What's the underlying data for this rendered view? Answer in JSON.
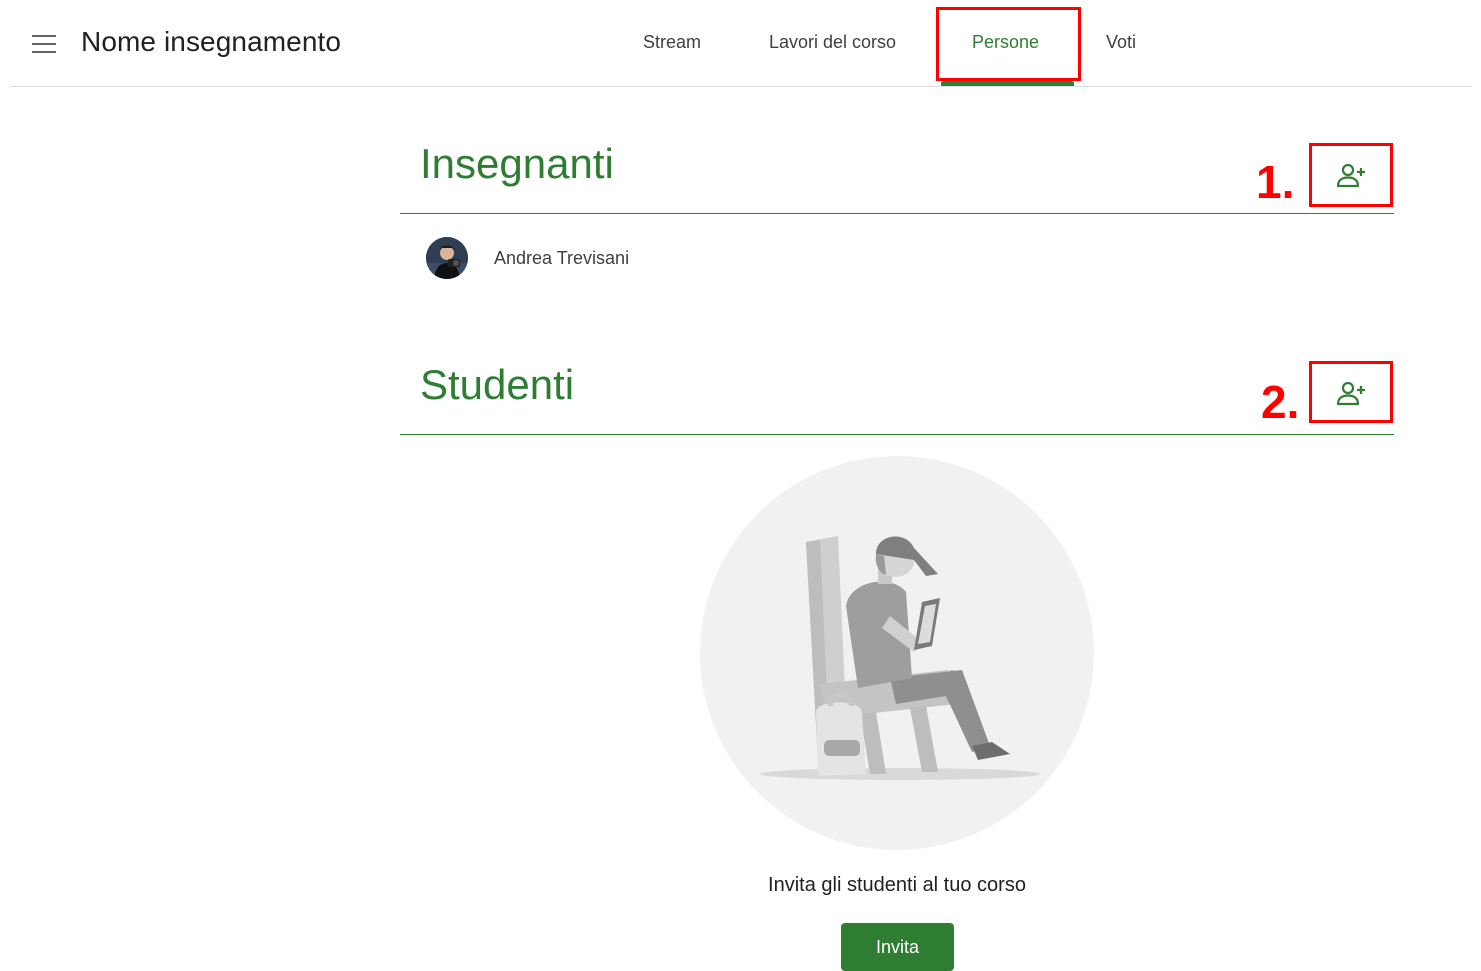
{
  "header": {
    "menu_icon": "hamburger-menu-icon",
    "course_title": "Nome insegnamento",
    "tabs": [
      {
        "label": "Stream",
        "active": false
      },
      {
        "label": "Lavori del corso",
        "active": false
      },
      {
        "label": "Persone",
        "active": true
      },
      {
        "label": "Voti",
        "active": false
      }
    ]
  },
  "teachers": {
    "title": "Insegnanti",
    "step_label": "1.",
    "add_icon": "person-add-icon",
    "list": [
      {
        "name": "Andrea Trevisani"
      }
    ]
  },
  "students": {
    "title": "Studenti",
    "step_label": "2.",
    "add_icon": "person-add-icon",
    "empty_message": "Invita gli studenti al tuo corso",
    "invite_label": "Invita"
  },
  "colors": {
    "accent_green": "#2e7d32",
    "annotation_red": "#ff0000",
    "divider": "#dadce0",
    "illustration_bg": "#f1f1f1"
  }
}
